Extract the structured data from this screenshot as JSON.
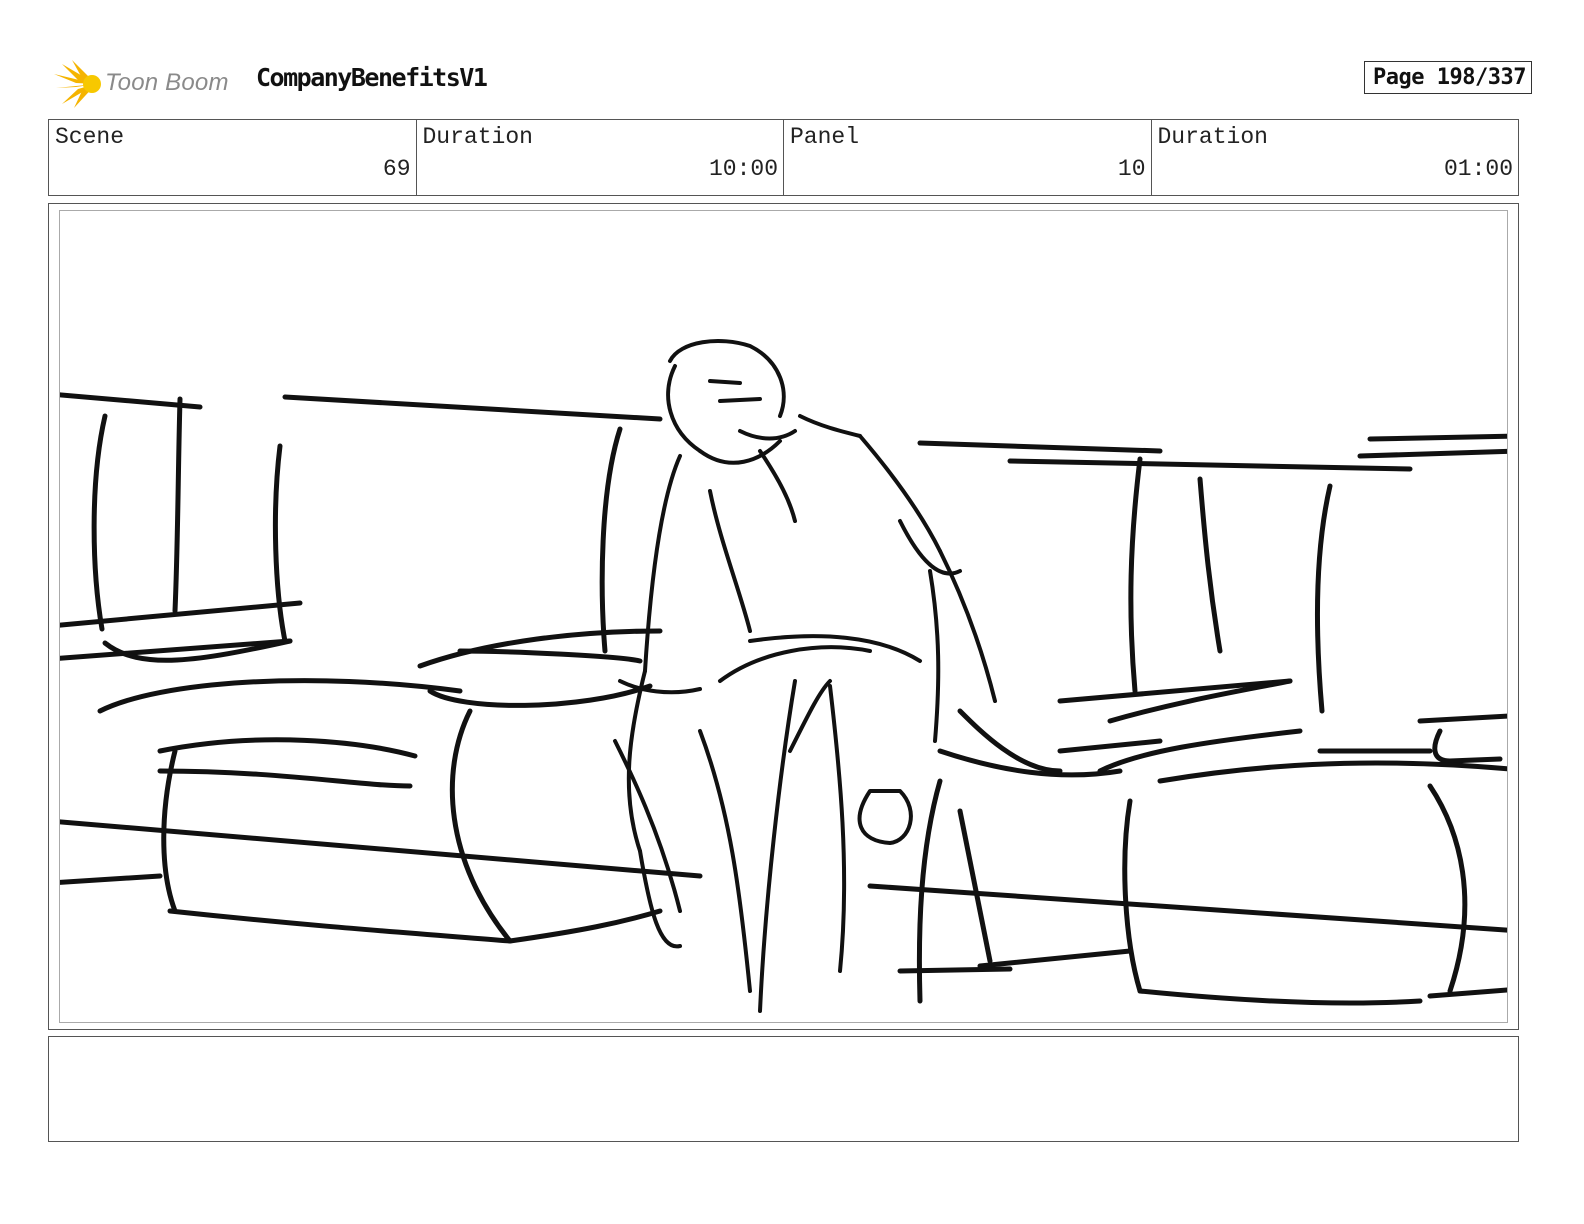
{
  "header": {
    "logo_text": "Toon Boom",
    "project_title": "CompanyBenefitsV1",
    "page_label": "Page 198/337"
  },
  "info": {
    "scene_label": "Scene",
    "scene_value": "69",
    "scene_duration_label": "Duration",
    "scene_duration_value": "10:00",
    "panel_label": "Panel",
    "panel_value": "10",
    "panel_duration_label": "Duration",
    "panel_duration_value": "01:00"
  },
  "notes": {
    "text": ""
  },
  "colors": {
    "logo_accent": "#f5b400",
    "logo_text": "#8a8a8a",
    "ink": "#111111"
  }
}
